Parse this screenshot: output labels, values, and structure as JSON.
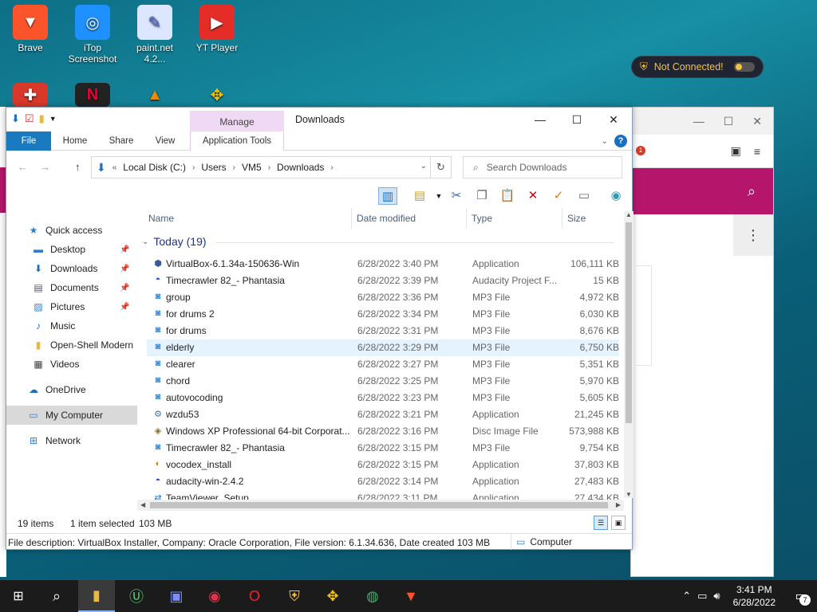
{
  "desktop": {
    "icons": [
      {
        "label": "Brave",
        "icon": "brave-icon",
        "color": "#fb542b"
      },
      {
        "label": "iTop Screenshot",
        "icon": "itop-screenshot-icon",
        "color": "#1e90ff"
      },
      {
        "label": "paint.net 4.2...",
        "icon": "paintnet-icon",
        "color": "#4466cc"
      },
      {
        "label": "YT Player",
        "icon": "yt-player-icon",
        "color": "#e52d27"
      }
    ]
  },
  "vpn": {
    "status": "Not Connected!",
    "accent": "#f5c141"
  },
  "browser": {
    "badge": "1"
  },
  "explorer": {
    "title": "Downloads",
    "context_tab": "Manage",
    "context_tab_color": "#f0d9f5",
    "ribbon_tabs": [
      "File",
      "Home",
      "Share",
      "View",
      "Application Tools"
    ],
    "address": {
      "prefix": "«",
      "crumbs": [
        "Local Disk (C:)",
        "Users",
        "VM5",
        "Downloads"
      ]
    },
    "search_placeholder": "Search Downloads",
    "nav": [
      {
        "label": "Quick access",
        "icon": "star-icon"
      },
      {
        "label": "Desktop",
        "icon": "desktop-icon",
        "pinned": true
      },
      {
        "label": "Downloads",
        "icon": "download-arrow-icon",
        "pinned": true
      },
      {
        "label": "Documents",
        "icon": "documents-icon",
        "pinned": true
      },
      {
        "label": "Pictures",
        "icon": "pictures-icon",
        "pinned": true
      },
      {
        "label": "Music",
        "icon": "music-icon"
      },
      {
        "label": "Open-Shell Modern",
        "icon": "folder-icon"
      },
      {
        "label": "Videos",
        "icon": "videos-icon"
      },
      {
        "label": "OneDrive",
        "icon": "cloud-icon"
      },
      {
        "label": "My Computer",
        "icon": "computer-icon",
        "selected": true
      },
      {
        "label": "Network",
        "icon": "network-icon"
      }
    ],
    "columns": [
      "Name",
      "Date modified",
      "Type",
      "Size"
    ],
    "group": "Today (19)",
    "files": [
      {
        "name": "VirtualBox-6.1.34a-150636-Win",
        "date": "6/28/2022 3:40 PM",
        "type": "Application",
        "size": "106,111 KB",
        "icon": "virtualbox-icon",
        "state": "selected"
      },
      {
        "name": "Timecrawler 82_- Phantasia",
        "date": "6/28/2022 3:39 PM",
        "type": "Audacity Project F...",
        "size": "15 KB",
        "icon": "audacity-icon",
        "state": ""
      },
      {
        "name": "group",
        "date": "6/28/2022 3:36 PM",
        "type": "MP3 File",
        "size": "4,972 KB",
        "icon": "mp3-file-icon",
        "state": ""
      },
      {
        "name": "for drums 2",
        "date": "6/28/2022 3:34 PM",
        "type": "MP3 File",
        "size": "6,030 KB",
        "icon": "mp3-file-icon",
        "state": ""
      },
      {
        "name": "for drums",
        "date": "6/28/2022 3:31 PM",
        "type": "MP3 File",
        "size": "8,676 KB",
        "icon": "mp3-file-icon",
        "state": ""
      },
      {
        "name": "elderly",
        "date": "6/28/2022 3:29 PM",
        "type": "MP3 File",
        "size": "6,750 KB",
        "icon": "mp3-file-icon",
        "state": "hover"
      },
      {
        "name": "clearer",
        "date": "6/28/2022 3:27 PM",
        "type": "MP3 File",
        "size": "5,351 KB",
        "icon": "mp3-file-icon",
        "state": ""
      },
      {
        "name": "chord",
        "date": "6/28/2022 3:25 PM",
        "type": "MP3 File",
        "size": "5,970 KB",
        "icon": "mp3-file-icon",
        "state": ""
      },
      {
        "name": "autovocoding",
        "date": "6/28/2022 3:23 PM",
        "type": "MP3 File",
        "size": "5,605 KB",
        "icon": "mp3-file-icon",
        "state": ""
      },
      {
        "name": "wzdu53",
        "date": "6/28/2022 3:21 PM",
        "type": "Application",
        "size": "21,245 KB",
        "icon": "installer-icon",
        "state": ""
      },
      {
        "name": "Windows XP Professional 64-bit Corporat...",
        "date": "6/28/2022 3:16 PM",
        "type": "Disc Image File",
        "size": "573,988 KB",
        "icon": "disc-image-icon",
        "state": ""
      },
      {
        "name": "Timecrawler 82_- Phantasia",
        "date": "6/28/2022 3:15 PM",
        "type": "MP3 File",
        "size": "9,754 KB",
        "icon": "mp3-file-icon",
        "state": ""
      },
      {
        "name": "vocodex_install",
        "date": "6/28/2022 3:15 PM",
        "type": "Application",
        "size": "37,803 KB",
        "icon": "vocodex-icon",
        "state": ""
      },
      {
        "name": "audacity-win-2.4.2",
        "date": "6/28/2022 3:14 PM",
        "type": "Application",
        "size": "27,483 KB",
        "icon": "audacity-icon",
        "state": ""
      },
      {
        "name": "TeamViewer_Setup",
        "date": "6/28/2022 3:11 PM",
        "type": "Application",
        "size": "27,434 KB",
        "icon": "teamviewer-icon",
        "state": ""
      }
    ],
    "status": {
      "count": "19 items",
      "selected": "1 item selected",
      "size": "103 MB"
    },
    "details": {
      "text": "File description: VirtualBox Installer, Company: Oracle Corporation, File version: 6.1.34.636, Date created 103 MB",
      "location": "Computer"
    }
  },
  "taskbar": {
    "time": "3:41 PM",
    "date": "6/28/2022",
    "notifications": "7"
  }
}
